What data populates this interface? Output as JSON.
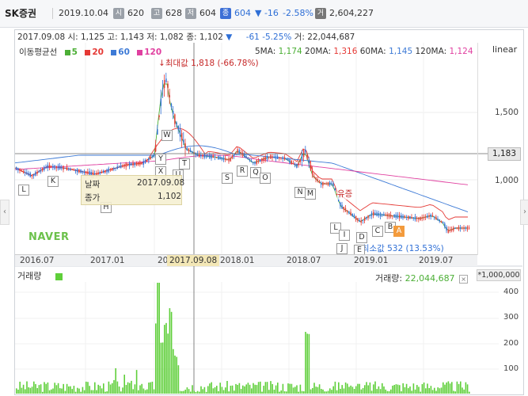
{
  "topbar": {
    "name": "SK증권",
    "date": "2019.10.04",
    "open_badge": "시",
    "open": "620",
    "high_badge": "고",
    "high": "628",
    "low_badge": "저",
    "low": "604",
    "close_badge": "종",
    "close": "604",
    "change": "▼ -16",
    "change_pct": "-2.58%",
    "volume_badge": "거",
    "volume": "2,604,227"
  },
  "infobar": {
    "date": "2017.09.08",
    "open": "시: 1,125",
    "high": "고: 1,143",
    "low": "저: 1,082",
    "close": "종: 1,102",
    "arrow": "▼",
    "change": "-61",
    "change_pct": "-5.25%",
    "volume": "거: 22,044,687"
  },
  "legend": {
    "title": "이동평균선",
    "items": [
      {
        "label": "5",
        "color": "#4caf36"
      },
      {
        "label": "20",
        "color": "#e53935"
      },
      {
        "label": "60",
        "color": "#3d7ad6"
      },
      {
        "label": "120",
        "color": "#e040a0"
      }
    ]
  },
  "ma_readout": {
    "ma5_label": "5MA:",
    "ma5": "1,174",
    "ma20_label": "20MA:",
    "ma20": "1,316",
    "ma60_label": "60MA:",
    "ma60": "1,145",
    "ma120_label": "120MA:",
    "ma120": "1,124"
  },
  "scale_mode": "linear",
  "y_ticks": [
    "1,500",
    "1,000"
  ],
  "current_price_box": "1,183",
  "x_ticks": [
    "2016.07",
    "2017.01",
    "20",
    "2017.09.08",
    "2018.01",
    "2018.07",
    "2019.01",
    "2019.07"
  ],
  "watermark": "NAVER",
  "tooltip": {
    "date_label": "날짜",
    "date_value": "2017.09.08",
    "close_label": "종가",
    "close_value": "1,102"
  },
  "max_annotation": "최대값 1,818 (-66.78%)",
  "min_annotation": "최소값 532 (13.53%)",
  "event_label": "유증",
  "flags": [
    "L",
    "K",
    "H",
    "W",
    "Y",
    "X",
    "U",
    "T",
    "S",
    "R",
    "Q",
    "O",
    "N",
    "M",
    "L",
    "I",
    "J",
    "E",
    "D",
    "C",
    "B",
    "A"
  ],
  "volume_panel": {
    "title": "거래량",
    "readout_label": "거래량:",
    "readout_value": "22,044,687",
    "unit": "*1,000,000",
    "ticks": [
      "400",
      "300",
      "200",
      "100"
    ]
  },
  "colors": {
    "up": "#e53935",
    "down": "#2f6fd6",
    "volume": "#5fcf3a",
    "crosshair": "#666666"
  }
}
